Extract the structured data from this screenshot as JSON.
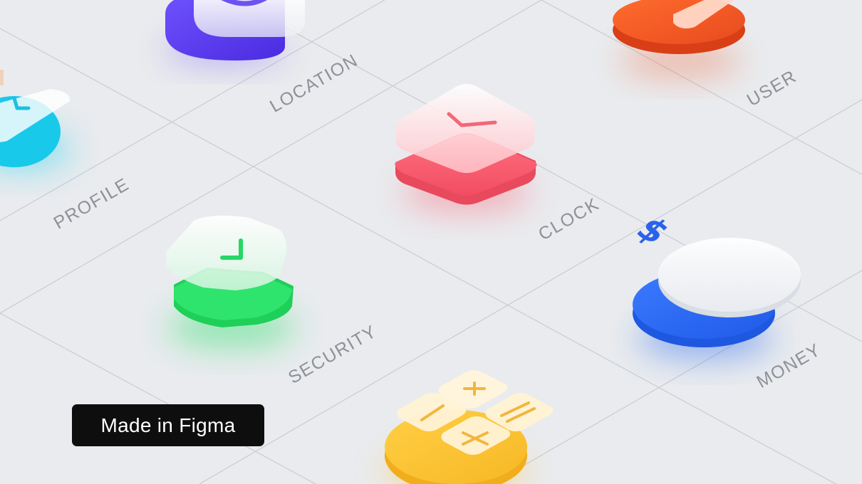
{
  "labels": {
    "location": "LOCATION",
    "user": "USER",
    "profile": "PROFILE",
    "clock": "CLOCK",
    "security": "SECURITY",
    "money": "MONEY"
  },
  "badge": {
    "text": "Made in Figma"
  },
  "money_symbol": "$",
  "colors": {
    "background": "#e9ebee",
    "location": "#5a3cf0",
    "user": "#f05a28",
    "profile": "#22d4f0",
    "clock": "#ff5f73",
    "security": "#2be06a",
    "money": "#2f6df0",
    "calculator": "#ffc43a"
  },
  "icons": [
    "location-pin-icon",
    "user-icon",
    "profile-check-icon",
    "clock-icon",
    "security-shield-icon",
    "money-dollar-icon",
    "calculator-icon"
  ]
}
